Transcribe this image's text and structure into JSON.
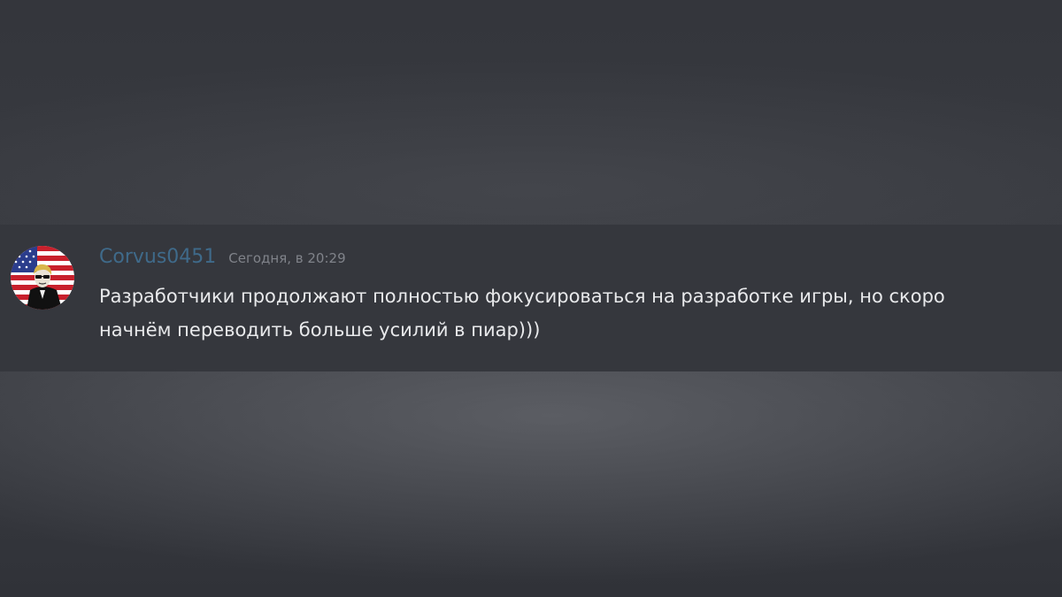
{
  "message": {
    "author": "Corvus0451",
    "timestamp": "Сегодня, в 20:29",
    "text": "Разработчики продолжают полностью фокусироваться на разработке игры, но скоро начнём переводить больше усилий в пиар)))"
  },
  "colors": {
    "background": "#36383e",
    "message_background": "#35373d",
    "author_color": "#3f6a8a",
    "timestamp_color": "#80838a",
    "text_color": "#e8e9eb"
  },
  "icons": {
    "avatar": "us-flag-figure-avatar"
  }
}
